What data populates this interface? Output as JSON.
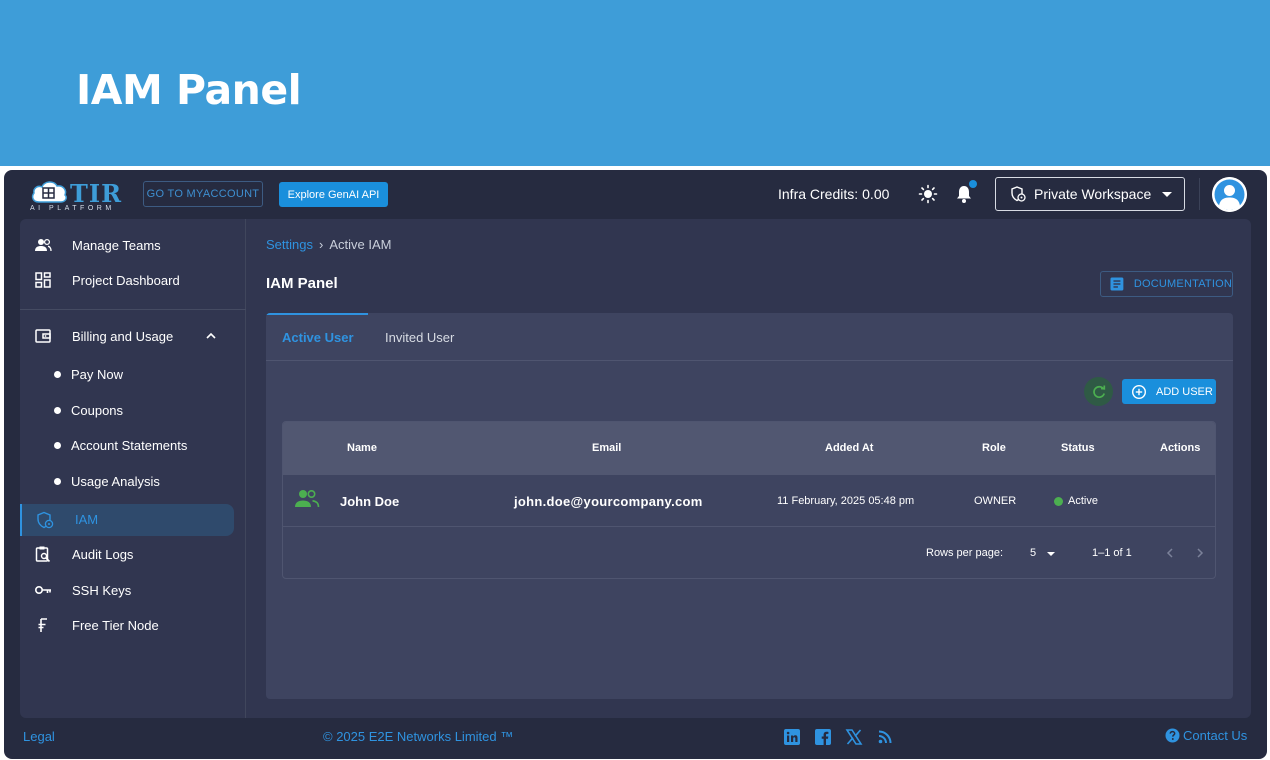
{
  "banner": {
    "title": "IAM Panel"
  },
  "header": {
    "logo_text": "TIR",
    "logo_subtitle": "AI PLATFORM",
    "go_myaccount_label": "GO TO MYACCOUNT",
    "explore_genai_label": "Explore GenAI API",
    "infra_credits_label": "Infra Credits:",
    "infra_credits_value": "0.00",
    "workspace_label": "Private Workspace",
    "theme_icon": "sun-icon",
    "notification_icon": "bell-icon",
    "accent": "#1a8fdc"
  },
  "sidebar": {
    "items": [
      {
        "label": "Manage Teams",
        "icon": "users-icon"
      },
      {
        "label": "Project Dashboard",
        "icon": "dashboard-icon"
      },
      {
        "label": "Billing and Usage",
        "icon": "wallet-icon"
      },
      {
        "label": "IAM",
        "icon": "iam-icon"
      },
      {
        "label": "Audit Logs",
        "icon": "clipboard-search-icon"
      },
      {
        "label": "SSH Keys",
        "icon": "key-icon"
      },
      {
        "label": "Free Tier Node",
        "icon": "free-tier-icon"
      }
    ],
    "billing_subitems": [
      "Pay Now",
      "Coupons",
      "Account Statements",
      "Usage Analysis"
    ],
    "active_item": "IAM"
  },
  "main": {
    "breadcrumb": {
      "link": "Settings",
      "separator": "›",
      "current": "Active IAM"
    },
    "title": "IAM Panel",
    "documentation_label": "DOCUMENTATION",
    "tabs": [
      {
        "label": "Active User",
        "active": true
      },
      {
        "label": "Invited User",
        "active": false
      }
    ],
    "add_user_label": "ADD USER",
    "table": {
      "columns": [
        "Name",
        "Email",
        "Added At",
        "Role",
        "Status",
        "Actions"
      ],
      "rows": [
        {
          "name": "John Doe",
          "email": "john.doe@yourcompany.com",
          "added_at": "11 February, 2025 05:48 pm",
          "role": "OWNER",
          "status": "Active",
          "status_color": "#4caf50"
        }
      ],
      "rows_per_page_label": "Rows per page:",
      "rows_per_page_value": "5",
      "pagination_range": "1–1 of 1"
    }
  },
  "footer": {
    "legal": "Legal",
    "copyright": "© 2025 E2E Networks Limited ™",
    "social_icons": [
      "linkedin-icon",
      "facebook-icon",
      "x-icon",
      "rss-icon"
    ],
    "contact": "Contact Us"
  }
}
